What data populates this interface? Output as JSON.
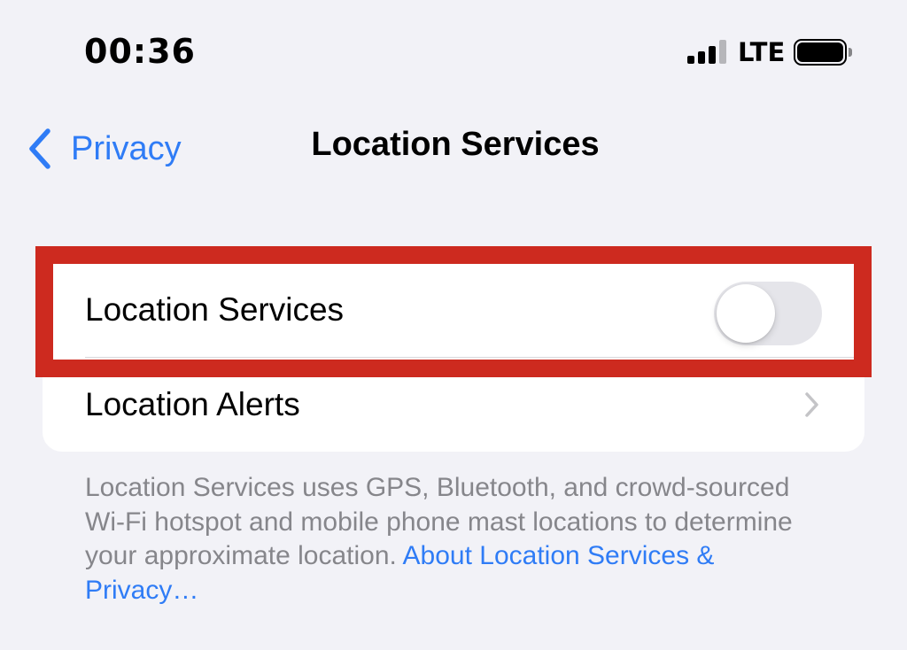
{
  "status_bar": {
    "time": "00:36",
    "network": "LTE",
    "signal_icon": "cellular-signal-icon",
    "battery_icon": "battery-icon"
  },
  "nav": {
    "back_label": "Privacy",
    "back_icon": "chevron-left-icon",
    "title": "Location Services"
  },
  "settings": {
    "rows": [
      {
        "label": "Location Services",
        "control": "toggle",
        "state": "off"
      },
      {
        "label": "Location Alerts",
        "control": "disclosure",
        "icon": "chevron-right-icon"
      }
    ]
  },
  "footer": {
    "text": "Location Services uses GPS, Bluetooth, and crowd-sourced Wi-Fi hotspot and mobile phone mast locations to determine your approximate location.",
    "link": "About Location Services & Privacy…"
  },
  "colors": {
    "accent": "#2f7cf6",
    "highlight": "#cd2a1f",
    "background": "#f2f2f7",
    "footer_text": "#86868b"
  }
}
